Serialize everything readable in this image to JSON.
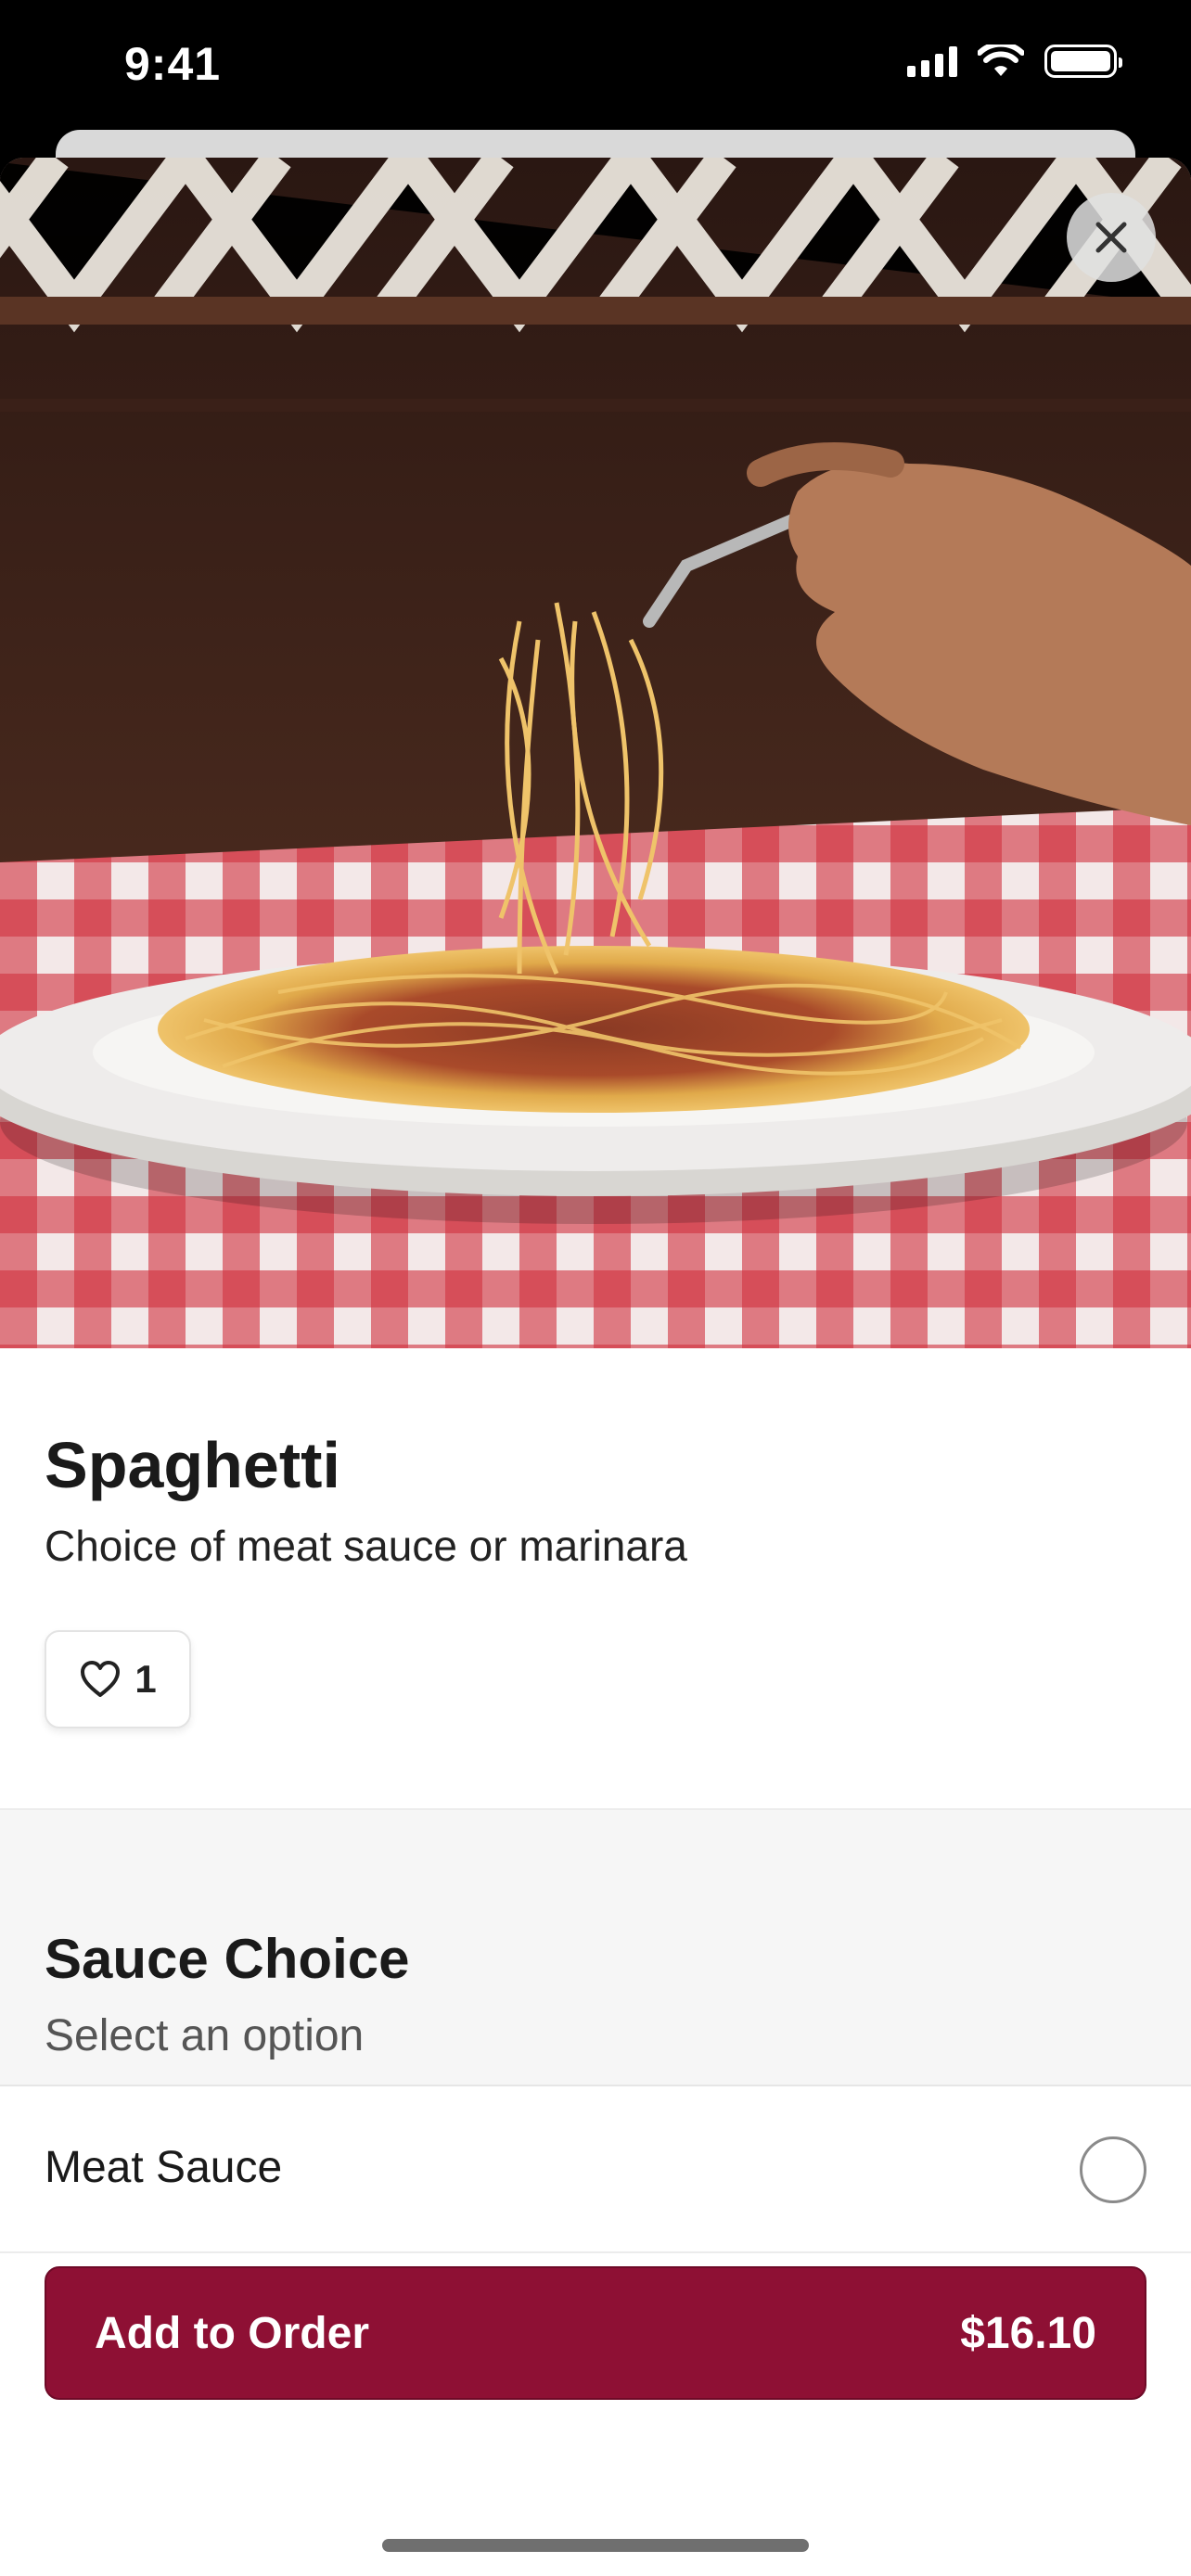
{
  "status_bar": {
    "time": "9:41",
    "icons": [
      "signal-icon",
      "wifi-icon",
      "battery-icon"
    ]
  },
  "hero": {
    "image": "photo of a forkful of spaghetti with meat sauce over a plate on a red checkered tablecloth",
    "close_icon": "close-icon"
  },
  "item": {
    "title": "Spaghetti",
    "description": "Choice of meat sauce or marinara",
    "like_icon": "heart-icon",
    "like_count": "1"
  },
  "option_group": {
    "title": "Sauce Choice",
    "subtitle": "Select an option",
    "options": [
      {
        "label": "Meat Sauce",
        "selected": false
      }
    ]
  },
  "footer": {
    "add_label": "Add to Order",
    "price": "$16.10"
  },
  "colors": {
    "accent": "#8e1034",
    "background": "#ffffff",
    "section_bg": "#f6f6f6"
  }
}
